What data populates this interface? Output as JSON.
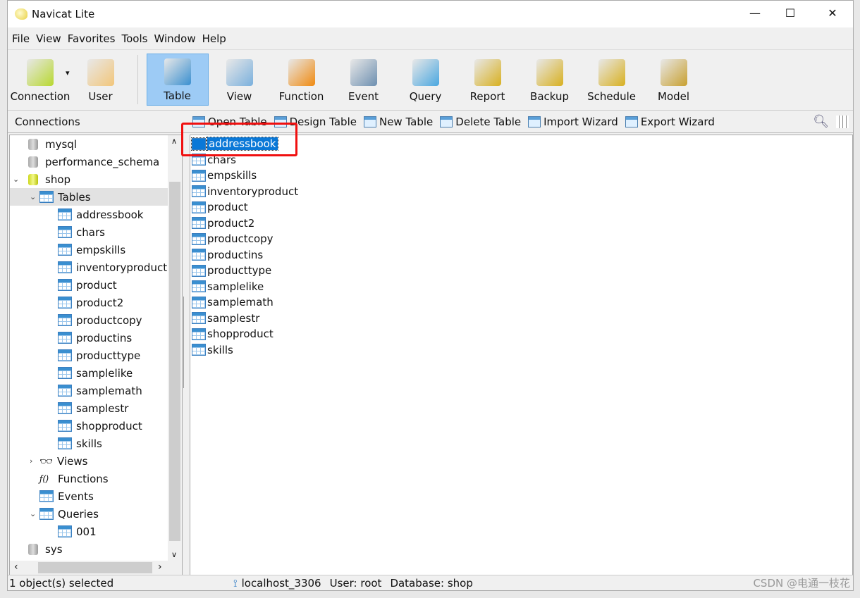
{
  "window": {
    "title": "Navicat Lite",
    "minimize": "—",
    "maximize": "☐",
    "close": "✕"
  },
  "menu": [
    "File",
    "View",
    "Favorites",
    "Tools",
    "Window",
    "Help"
  ],
  "toolbar": [
    {
      "label": "Connection",
      "icon": "connection-icon",
      "color": "#b8d830"
    },
    {
      "label": "User",
      "icon": "user-icon",
      "color": "#f2c67a"
    },
    {
      "label": "Table",
      "icon": "table-icon",
      "color": "#3a8fd0",
      "active": true
    },
    {
      "label": "View",
      "icon": "view-icon",
      "color": "#7ab0dd"
    },
    {
      "label": "Function",
      "icon": "function-icon",
      "color": "#f08a10"
    },
    {
      "label": "Event",
      "icon": "event-icon",
      "color": "#6d8fb0"
    },
    {
      "label": "Query",
      "icon": "query-icon",
      "color": "#4aa7e0"
    },
    {
      "label": "Report",
      "icon": "report-lock-icon",
      "color": "#d8b020"
    },
    {
      "label": "Backup",
      "icon": "backup-lock-icon",
      "color": "#d8b020"
    },
    {
      "label": "Schedule",
      "icon": "schedule-lock-icon",
      "color": "#d8b020"
    },
    {
      "label": "Model",
      "icon": "model-lock-icon",
      "color": "#c8a030"
    }
  ],
  "subbar": {
    "connections": "Connections",
    "actions": [
      "Open Table",
      "Design Table",
      "New Table",
      "Delete Table",
      "Import Wizard",
      "Export Wizard"
    ]
  },
  "tree": [
    {
      "label": "mysql",
      "type": "db",
      "indent": 0
    },
    {
      "label": "performance_schema",
      "type": "db",
      "indent": 0
    },
    {
      "label": "shop",
      "type": "db-open",
      "indent": 0,
      "arrow": "⌄"
    },
    {
      "label": "Tables",
      "type": "folder",
      "indent": 1,
      "arrow": "⌄",
      "selected": true
    },
    {
      "label": "addressbook",
      "type": "table",
      "indent": 2
    },
    {
      "label": "chars",
      "type": "table",
      "indent": 2
    },
    {
      "label": "empskills",
      "type": "table",
      "indent": 2
    },
    {
      "label": "inventoryproduct",
      "type": "table",
      "indent": 2
    },
    {
      "label": "product",
      "type": "table",
      "indent": 2
    },
    {
      "label": "product2",
      "type": "table",
      "indent": 2
    },
    {
      "label": "productcopy",
      "type": "table",
      "indent": 2
    },
    {
      "label": "productins",
      "type": "table",
      "indent": 2
    },
    {
      "label": "producttype",
      "type": "table",
      "indent": 2
    },
    {
      "label": "samplelike",
      "type": "table",
      "indent": 2
    },
    {
      "label": "samplemath",
      "type": "table",
      "indent": 2
    },
    {
      "label": "samplestr",
      "type": "table",
      "indent": 2
    },
    {
      "label": "shopproduct",
      "type": "table",
      "indent": 2
    },
    {
      "label": "skills",
      "type": "table",
      "indent": 2
    },
    {
      "label": "Views",
      "type": "views",
      "indent": 1,
      "arrow": "›"
    },
    {
      "label": "Functions",
      "type": "functions",
      "indent": 1
    },
    {
      "label": "Events",
      "type": "events",
      "indent": 1
    },
    {
      "label": "Queries",
      "type": "folder",
      "indent": 1,
      "arrow": "⌄"
    },
    {
      "label": "001",
      "type": "query",
      "indent": 2
    },
    {
      "label": "sys",
      "type": "db",
      "indent": 0
    }
  ],
  "tables": [
    "addressbook",
    "chars",
    "empskills",
    "inventoryproduct",
    "product",
    "product2",
    "productcopy",
    "productins",
    "producttype",
    "samplelike",
    "samplemath",
    "samplestr",
    "shopproduct",
    "skills"
  ],
  "selected_table": "addressbook",
  "status": {
    "selection": "1 object(s) selected",
    "connection": "localhost_3306",
    "user": "User: root",
    "database": "Database: shop",
    "watermark": "CSDN @电通一枝花"
  }
}
